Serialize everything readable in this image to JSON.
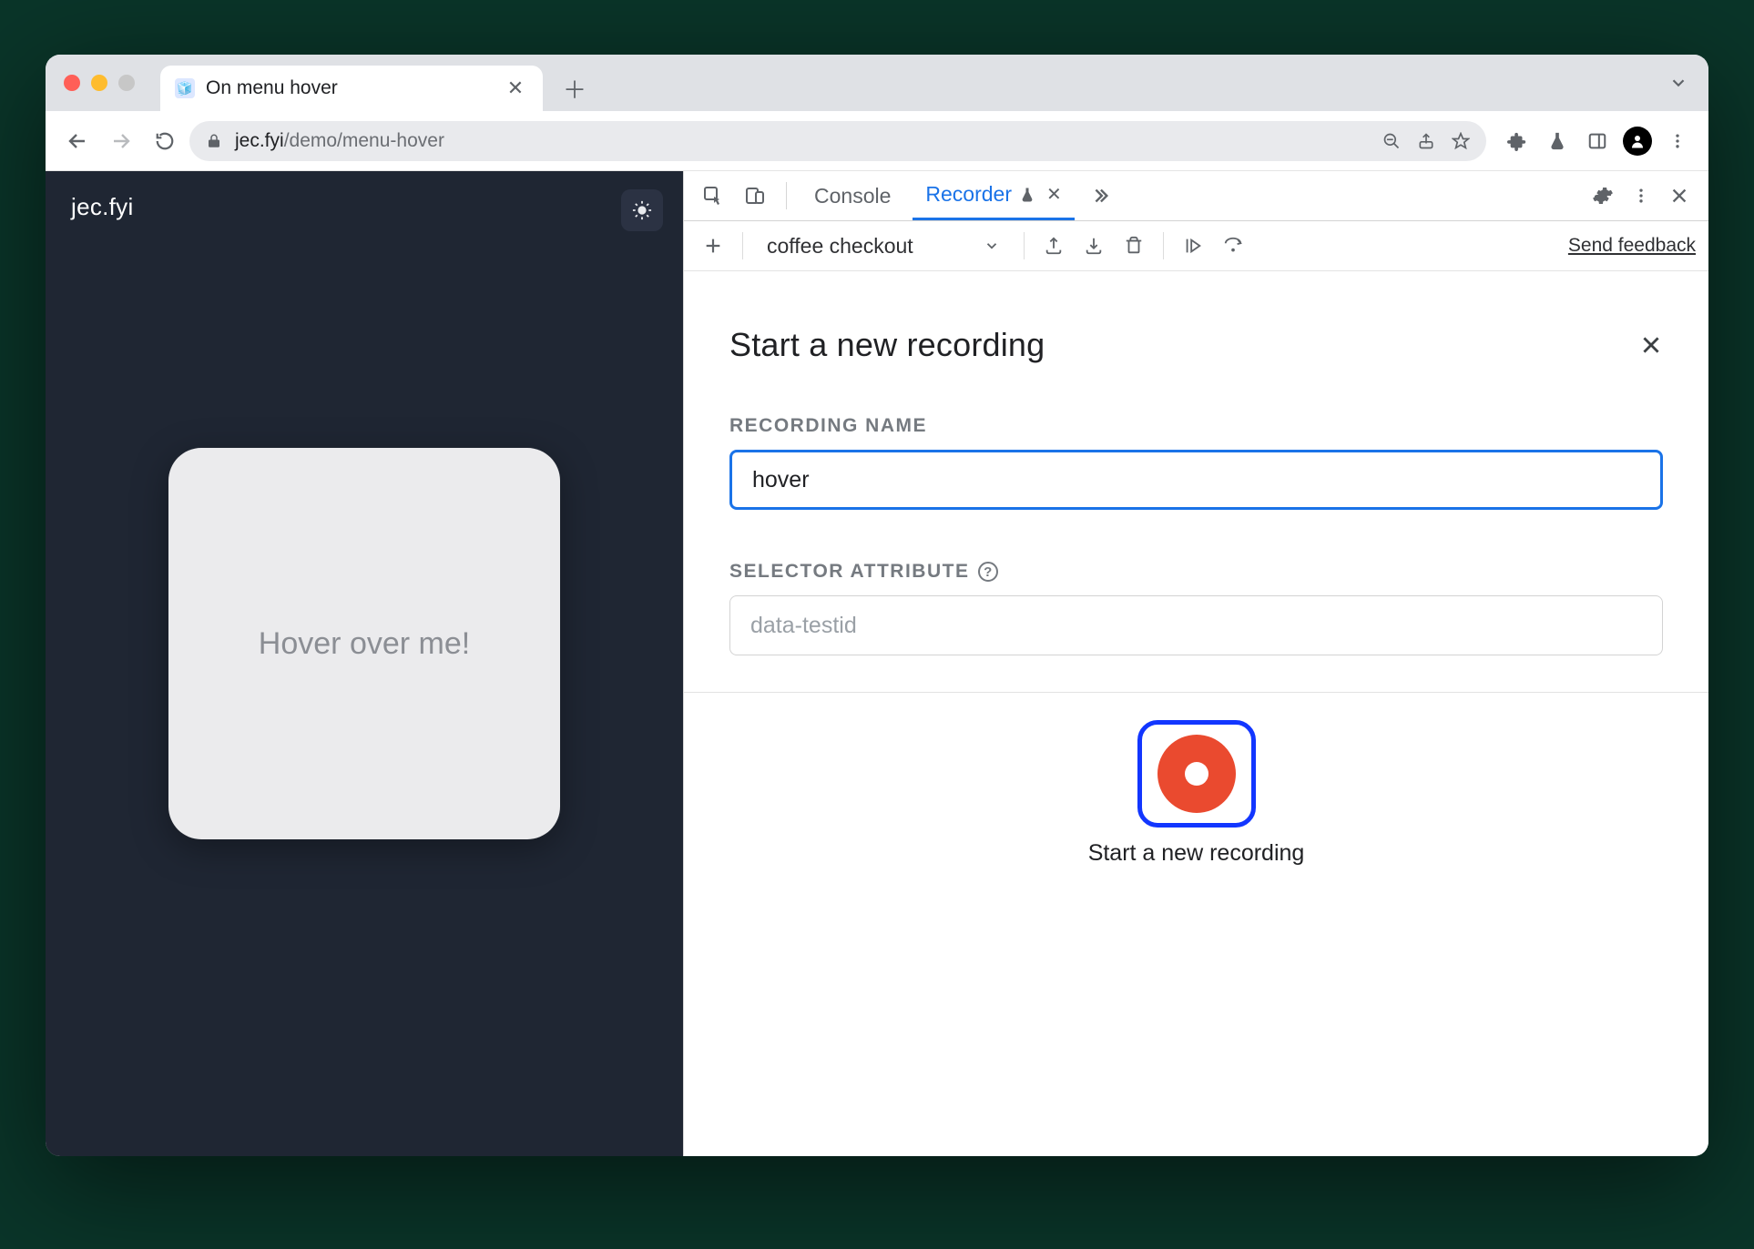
{
  "window": {
    "tab_title": "On menu hover",
    "url_host": "jec.fyi",
    "url_path": "/demo/menu-hover"
  },
  "page": {
    "brand": "jec.fyi",
    "card_text": "Hover over me!"
  },
  "devtools": {
    "tabs": {
      "console": "Console",
      "recorder": "Recorder"
    },
    "toolbar": {
      "recording_select": "coffee checkout",
      "send_feedback": "Send feedback"
    },
    "form": {
      "title": "Start a new recording",
      "name_label": "RECORDING NAME",
      "name_value": "hover",
      "selector_label": "SELECTOR ATTRIBUTE",
      "selector_placeholder": "data-testid",
      "record_caption": "Start a new recording"
    }
  }
}
